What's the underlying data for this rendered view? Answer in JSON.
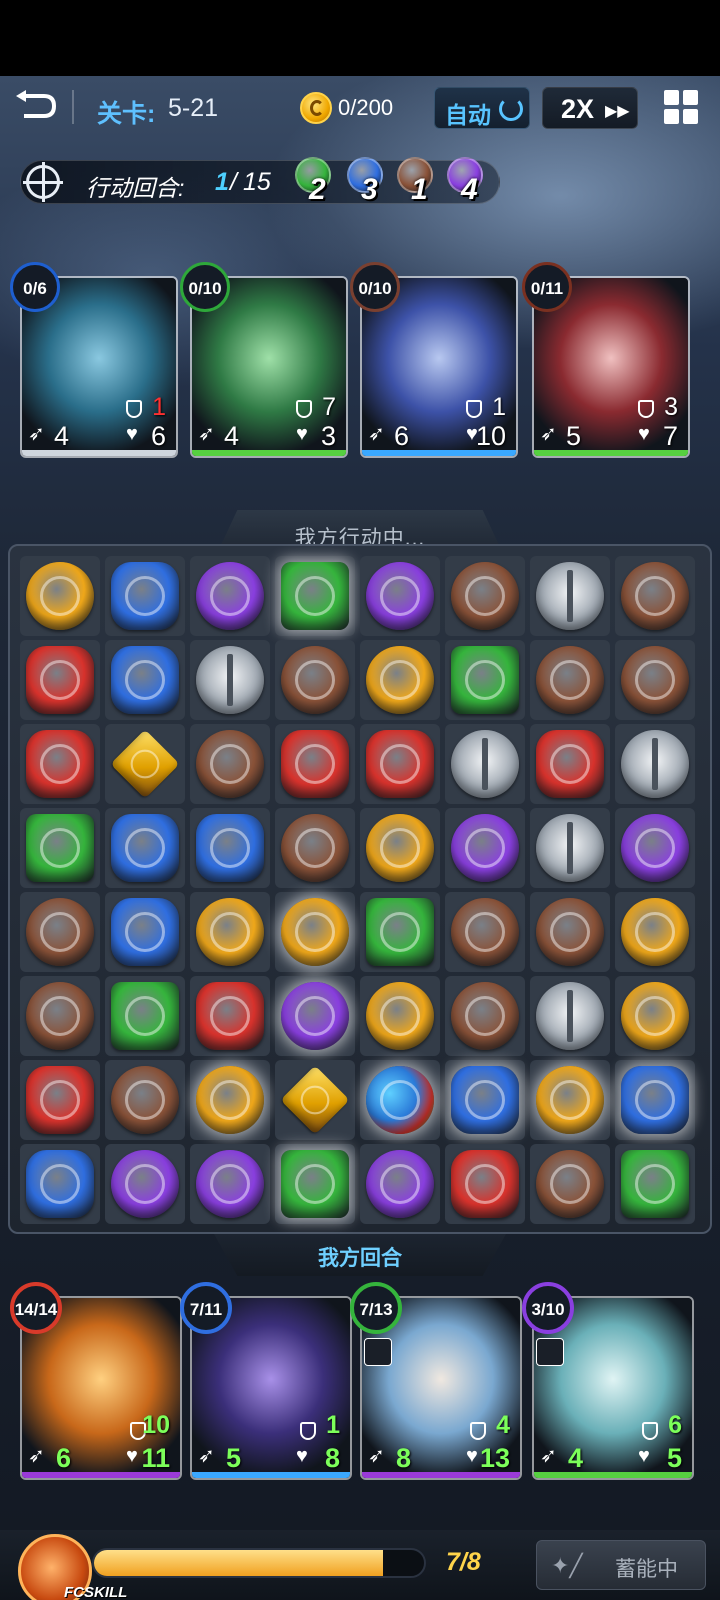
{
  "topbar": {
    "back_icon": "back-arrow-icon",
    "level_label": "关卡:",
    "level_value": "5-21",
    "coin_icon": "coin-icon",
    "coins": "0/200",
    "auto_label": "自动",
    "auto_icon": "refresh-icon",
    "speed_label": "2X",
    "speed_icon": "fast-forward-icon",
    "menu_icon": "grid-menu-icon"
  },
  "turn": {
    "label": "行动回合:",
    "current": "1",
    "separator": "/",
    "total": "15",
    "element_counts": [
      {
        "element": "green",
        "color": "#35b43c",
        "count": "2"
      },
      {
        "element": "blue",
        "color": "#2f6ee0",
        "count": "3"
      },
      {
        "element": "brown",
        "color": "#8a5238",
        "count": "1"
      },
      {
        "element": "purple",
        "color": "#8a3fe0",
        "count": "4"
      }
    ]
  },
  "enemies": [
    {
      "name": "blue-armored-golem",
      "badge": "0/6",
      "badge_color": "#1e5fd0",
      "def": "1",
      "def_color": "#ff3030",
      "spd": "4",
      "hp": "6",
      "color": "#2a6e8a",
      "accent": "#8ac8e0",
      "bottom": "#cfd6de"
    },
    {
      "name": "green-armored-golem",
      "badge": "0/10",
      "badge_color": "#2ea83a",
      "def": "7",
      "def_color": "#ffffff",
      "spd": "4",
      "hp": "3",
      "color": "#2f7a45",
      "accent": "#9fe0a8",
      "bottom": "#56d040"
    },
    {
      "name": "blue-beast-demon",
      "badge": "0/10",
      "badge_color": "#7a4030",
      "def": "1",
      "def_color": "#ffffff",
      "spd": "6",
      "hp": "10",
      "color": "#3d52a8",
      "accent": "#b8c8f0",
      "bottom": "#3aa8ff"
    },
    {
      "name": "red-armored-golem",
      "badge": "0/11",
      "badge_color": "#7a3020",
      "def": "3",
      "def_color": "#ffffff",
      "spd": "5",
      "hp": "7",
      "color": "#8a2a30",
      "accent": "#f0c0c0",
      "bottom": "#56d040"
    }
  ],
  "board": {
    "header": "我方行动中...",
    "footer": "我方回合",
    "grid": [
      [
        "yellow",
        "blue",
        "purple",
        "green",
        "purple",
        "brown",
        "sword",
        "brown"
      ],
      [
        "red",
        "blue",
        "sword",
        "brown",
        "yellow",
        "green",
        "brown",
        "brown"
      ],
      [
        "red",
        "box",
        "brown",
        "red",
        "red",
        "sword",
        "red",
        "sword"
      ],
      [
        "green",
        "blue",
        "blue",
        "brown",
        "yellow",
        "purple",
        "sword",
        "purple"
      ],
      [
        "brown",
        "blue",
        "yellow",
        "yellow",
        "green",
        "brown",
        "brown",
        "yellow"
      ],
      [
        "brown",
        "green",
        "red",
        "purple",
        "yellow",
        "brown",
        "sword",
        "yellow"
      ],
      [
        "red",
        "brown",
        "yellow",
        "box",
        "rainbow",
        "blue",
        "yellow",
        "blue"
      ],
      [
        "blue",
        "purple",
        "purple",
        "green",
        "purple",
        "red",
        "brown",
        "green"
      ]
    ],
    "colors": {
      "yellow": "#f0a81a",
      "blue": "#2f6ee0",
      "purple": "#8a3fe0",
      "green": "#35b43c",
      "brown": "#8a5238",
      "red": "#d8322c",
      "rainbow": "#3fb0e8"
    }
  },
  "heroes": [
    {
      "name": "fire-dragon-hero",
      "badge": "14/14",
      "badge_color": "#d83a2a",
      "def": "10",
      "spd": "6",
      "hp": "11",
      "color": "#c8681a",
      "accent": "#ffd080",
      "bottom": "#9a3ad8"
    },
    {
      "name": "dark-mage-hero",
      "badge": "7/11",
      "badge_color": "#2f6ee0",
      "def": "1",
      "spd": "5",
      "hp": "8",
      "color": "#3b2f7a",
      "accent": "#a890e8",
      "bottom": "#3aa8ff"
    },
    {
      "name": "blue-fox-hero",
      "badge": "7/13",
      "badge_color": "#35b43c",
      "def": "4",
      "spd": "8",
      "hp": "13",
      "color": "#7aa8d0",
      "accent": "#f0e8e0",
      "bottom": "#9a3ad8"
    },
    {
      "name": "aqua-maiden-hero",
      "badge": "3/10",
      "badge_color": "#8a3fe0",
      "def": "6",
      "spd": "4",
      "hp": "5",
      "color": "#6ab0b8",
      "accent": "#e0f4f4",
      "bottom": "#56d040"
    }
  ],
  "bottombar": {
    "fc_label": "FCSKILL",
    "energy_text": "7/8",
    "energy_fraction": 0.875,
    "charge_icon": "magic-wand-icon",
    "charge_label": "蓄能中"
  }
}
